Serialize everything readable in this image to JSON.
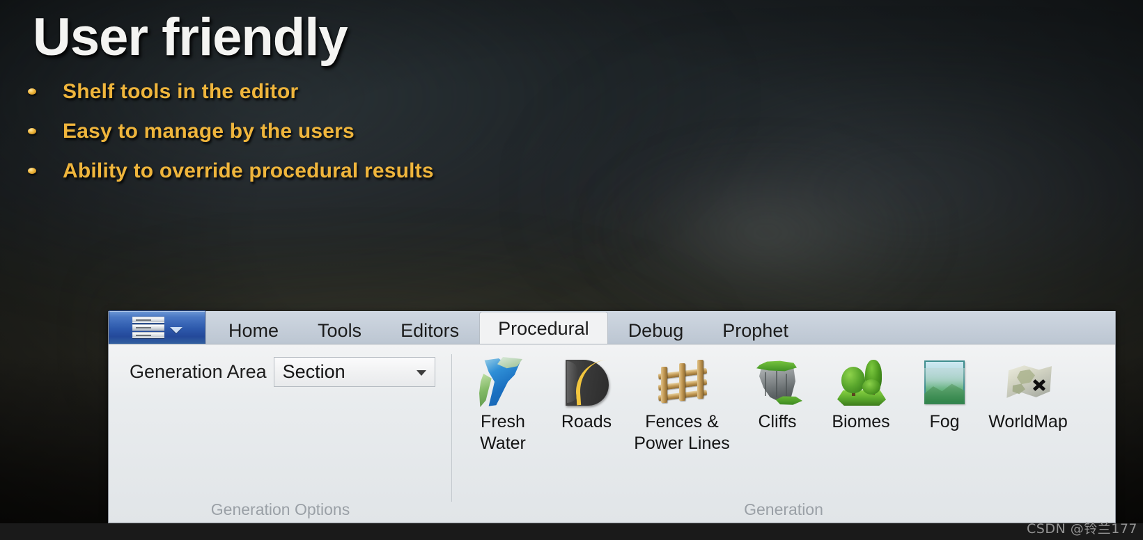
{
  "slide": {
    "title": "User friendly",
    "bullets": [
      "Shelf tools in the editor",
      "Easy to manage by the users",
      "Ability to override procedural results"
    ],
    "title_color": "#f4f4f2",
    "bullet_color": "#efb53c"
  },
  "ribbon": {
    "app_button_label": "",
    "tabs": [
      {
        "label": "Home",
        "active": false
      },
      {
        "label": "Tools",
        "active": false
      },
      {
        "label": "Editors",
        "active": false
      },
      {
        "label": "Procedural",
        "active": true
      },
      {
        "label": "Debug",
        "active": false
      },
      {
        "label": "Prophet",
        "active": false
      }
    ],
    "groups": [
      {
        "name": "generation-options",
        "label": "Generation Options",
        "field_label": "Generation Area",
        "select_value": "Section"
      },
      {
        "name": "generation",
        "label": "Generation",
        "buttons": [
          {
            "icon": "fresh-water-icon",
            "label": "Fresh\nWater"
          },
          {
            "icon": "roads-icon",
            "label": "Roads"
          },
          {
            "icon": "fences-icon",
            "label": "Fences &\nPower Lines"
          },
          {
            "icon": "cliffs-icon",
            "label": "Cliffs"
          },
          {
            "icon": "biomes-icon",
            "label": "Biomes"
          },
          {
            "icon": "fog-icon",
            "label": "Fog"
          },
          {
            "icon": "worldmap-icon",
            "label": "WorldMap"
          }
        ]
      }
    ],
    "accent_color": "#2e5aad",
    "surface_color": "#e1e5e8"
  },
  "watermark": {
    "text": "CSDN @铃兰177"
  }
}
